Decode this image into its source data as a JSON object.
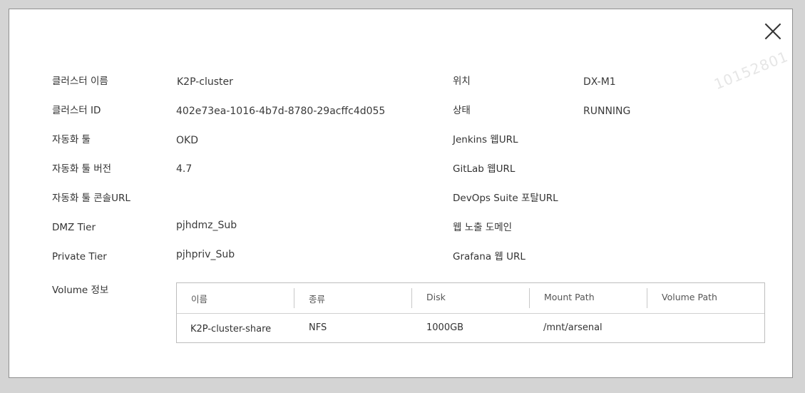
{
  "watermark": "10152801",
  "left_fields": [
    {
      "label": "클러스터 이름",
      "value": "K2P-cluster"
    },
    {
      "label": "클러스터 ID",
      "value": "402e73ea-1016-4b7d-8780-29acffc4d055"
    },
    {
      "label": "자동화 툴",
      "value": "OKD"
    },
    {
      "label": "자동화 툴 버전",
      "value": "4.7"
    },
    {
      "label": "자동화 툴 콘솔URL",
      "value": ""
    },
    {
      "label": "DMZ Tier",
      "value": "pjhdmz_Sub"
    },
    {
      "label": "Private Tier",
      "value": "pjhpriv_Sub"
    }
  ],
  "right_fields": [
    {
      "label": "위치",
      "value": "DX-M1"
    },
    {
      "label": "상태",
      "value": "RUNNING"
    },
    {
      "label": "Jenkins 웹URL",
      "value": ""
    },
    {
      "label": "GitLab 웹URL",
      "value": ""
    },
    {
      "label": "DevOps Suite 포탈URL",
      "value": ""
    },
    {
      "label": "웹 노출 도메인",
      "value": ""
    },
    {
      "label": "Grafana 웹 URL",
      "value": ""
    }
  ],
  "volume": {
    "label": "Volume 정보",
    "headers": [
      "이름",
      "종류",
      "Disk",
      "Mount Path",
      "Volume Path"
    ],
    "rows": [
      [
        "K2P-cluster-share",
        "NFS",
        "1000GB",
        "/mnt/arsenal",
        ""
      ]
    ]
  }
}
